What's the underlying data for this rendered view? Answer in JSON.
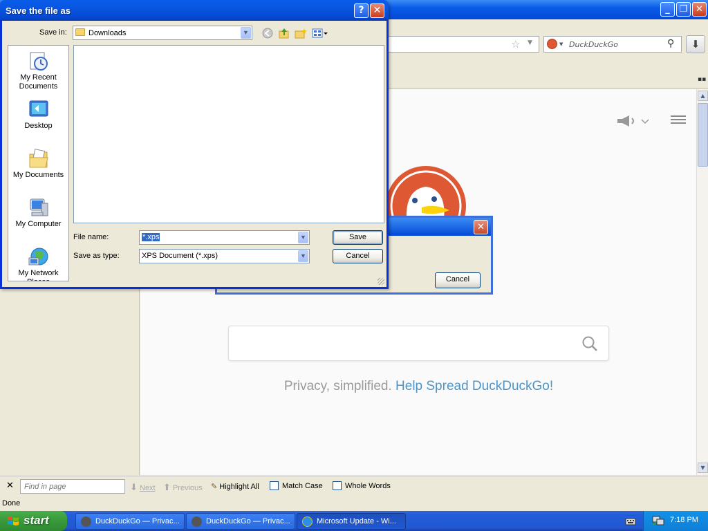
{
  "firefox": {
    "search_placeholder": "DuckDuckGo",
    "status": "Done",
    "findbar": {
      "placeholder": "Find in page",
      "next": "Next",
      "previous": "Previous",
      "highlight_all": "Highlight All",
      "match_case": "Match Case",
      "whole_words": "Whole Words"
    }
  },
  "ddg": {
    "tagline": "Privacy, simplified.",
    "tagline_link": "Help Spread DuckDuckGo!"
  },
  "bg_dialog": {
    "cancel": "Cancel"
  },
  "save_dialog": {
    "title": "Save the file as",
    "save_in_label": "Save in:",
    "save_in_value": "Downloads",
    "places": [
      {
        "label": "My Recent Documents"
      },
      {
        "label": "Desktop"
      },
      {
        "label": "My Documents"
      },
      {
        "label": "My Computer"
      },
      {
        "label": "My Network Places"
      }
    ],
    "file_name_label": "File name:",
    "file_name_value": "*.xps",
    "save_type_label": "Save as type:",
    "save_type_value": "XPS Document (*.xps)",
    "save_button": "Save",
    "cancel_button": "Cancel"
  },
  "taskbar": {
    "start": "start",
    "tasks": [
      {
        "label": "DuckDuckGo — Privac..."
      },
      {
        "label": "DuckDuckGo — Privac..."
      },
      {
        "label": "Microsoft Update - Wi..."
      }
    ],
    "clock": "7:18 PM"
  },
  "colors": {
    "xp_blue": "#0a5ce8",
    "ddg_orange": "#de5833",
    "ddg_link": "#4e94c6"
  }
}
